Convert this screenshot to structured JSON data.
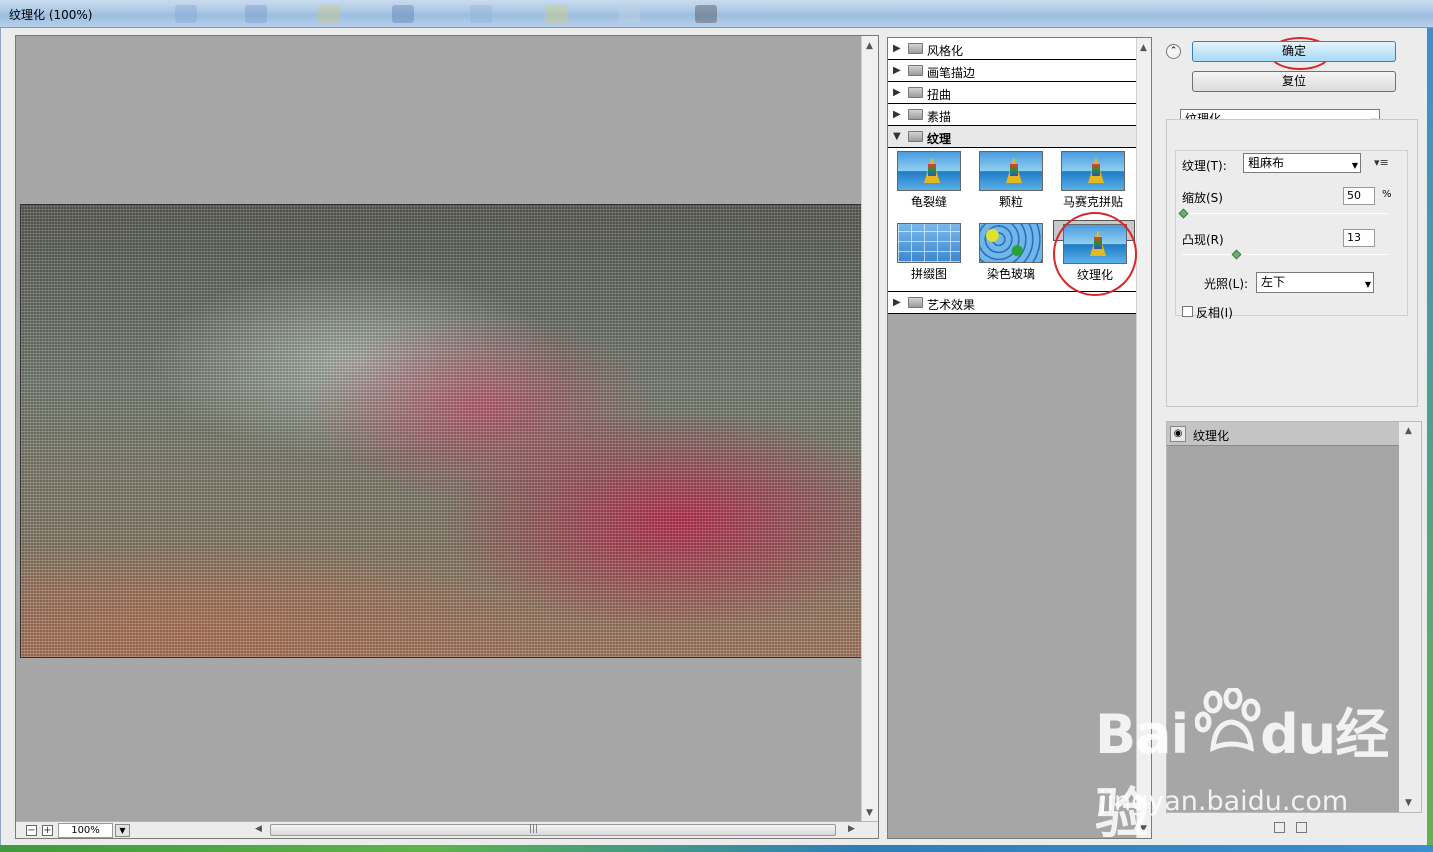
{
  "window": {
    "title": "纹理化 (100%)"
  },
  "preview": {
    "zoom_value": "100%",
    "zoom_out": "−",
    "zoom_in": "+",
    "scroll_grip": "|||",
    "dropdown_arrow": "▼"
  },
  "gallery": {
    "categories": [
      {
        "label": "风格化",
        "expanded": false
      },
      {
        "label": "画笔描边",
        "expanded": false
      },
      {
        "label": "扭曲",
        "expanded": false
      },
      {
        "label": "素描",
        "expanded": false
      },
      {
        "label": "纹理",
        "expanded": true
      },
      {
        "label": "艺术效果",
        "expanded": false
      }
    ],
    "texture_filters": [
      {
        "label": "龟裂缝"
      },
      {
        "label": "颗粒"
      },
      {
        "label": "马赛克拼贴"
      },
      {
        "label": "拼缀图"
      },
      {
        "label": "染色玻璃"
      },
      {
        "label": "纹理化",
        "selected": true
      }
    ]
  },
  "settings": {
    "ok_label": "确定",
    "reset_label": "复位",
    "filter_select": "纹理化",
    "texture_label": "纹理(T):",
    "texture_value": "粗麻布",
    "scale_label": "缩放(S)",
    "scale_value": "50",
    "scale_unit": "%",
    "scale_level": 50,
    "relief_label": "凸现(R)",
    "relief_value": "13",
    "relief_level": 13,
    "light_label": "光照(L):",
    "light_value": "左下",
    "invert_label": "反相(I)",
    "invert_checked": false
  },
  "layers": {
    "items": [
      {
        "label": "纹理化",
        "visible": true
      }
    ]
  },
  "watermark": {
    "logo_text": "Bai  du 经验",
    "url": "jingyan.baidu.com"
  },
  "colors": {
    "highlight_circle": "#d8262b",
    "ok_button": "#a7d9f5",
    "canvas_bg": "#a6a6a6"
  }
}
